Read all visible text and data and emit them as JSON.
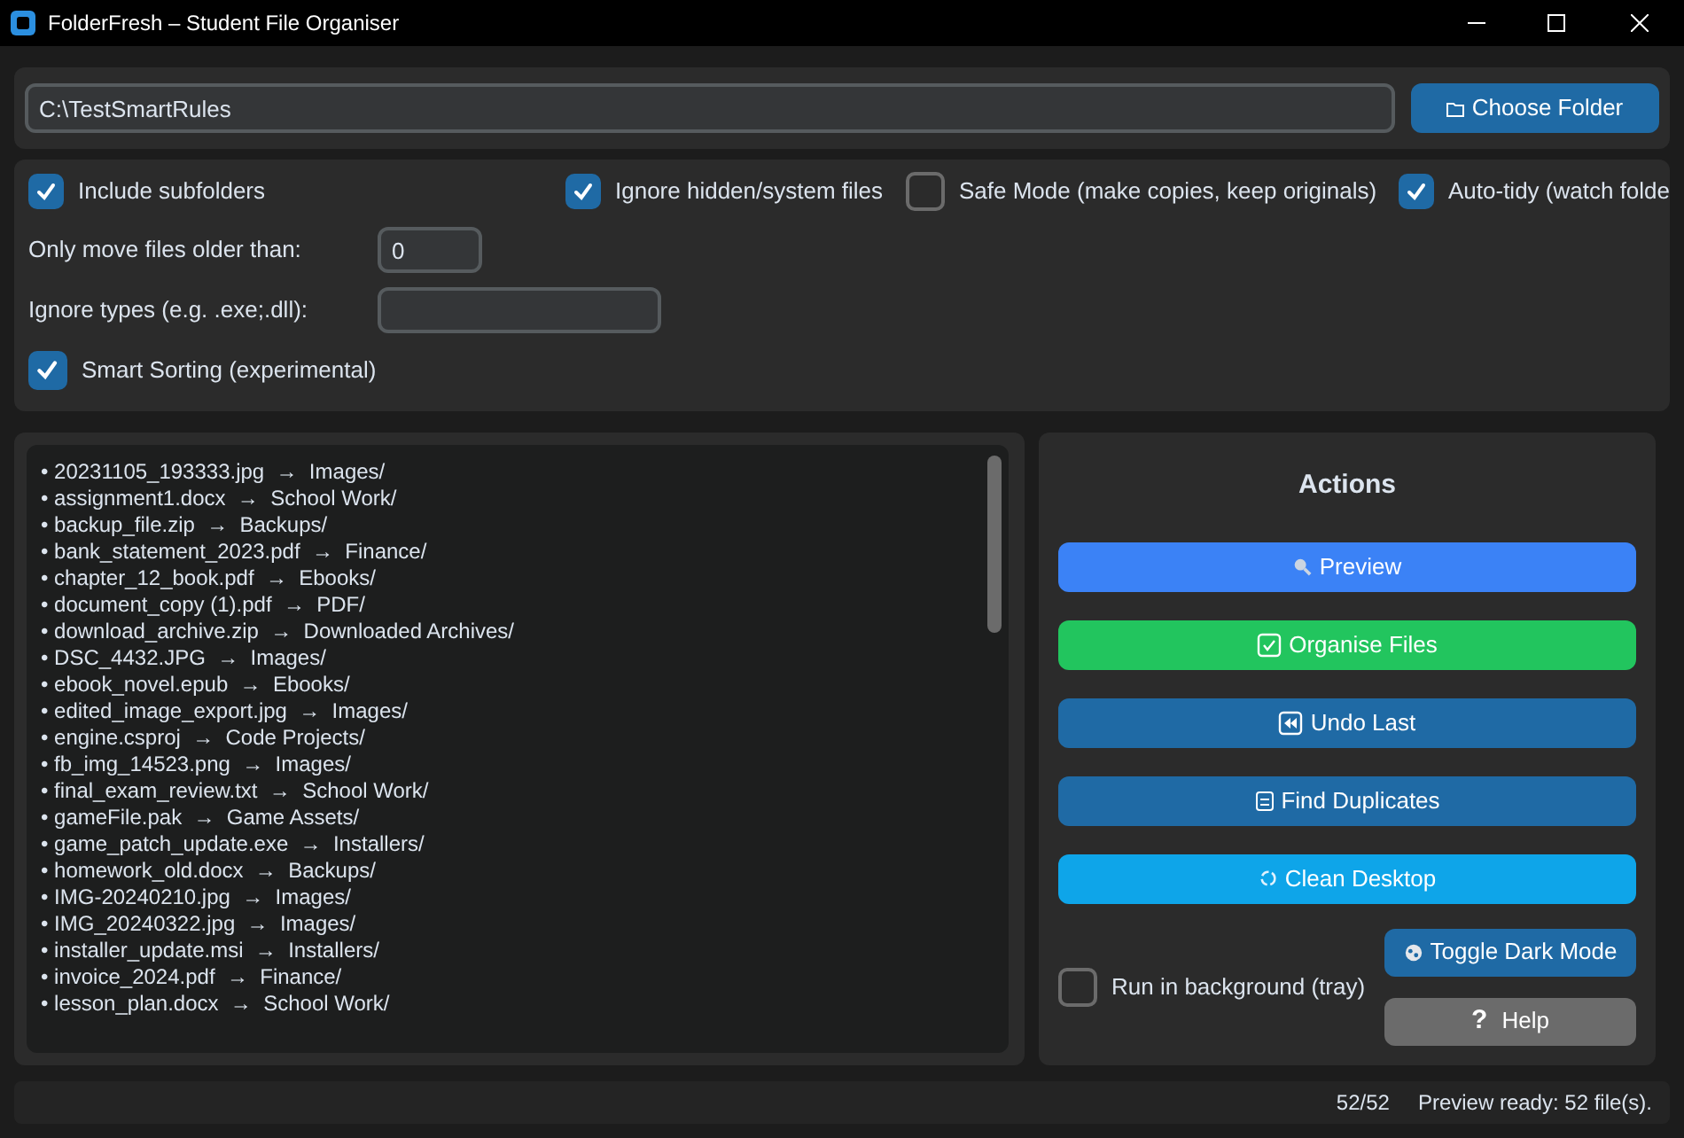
{
  "window": {
    "title": "FolderFresh – Student File Organiser"
  },
  "folder": {
    "path": "C:\\TestSmartRules",
    "button": "Choose Folder"
  },
  "options": [
    {
      "label": "Include subfolders",
      "checked": true
    },
    {
      "label": "Ignore hidden/system files",
      "checked": true
    },
    {
      "label": "Safe Mode (make copies, keep originals)",
      "checked": false
    },
    {
      "label": "Auto-tidy (watch folde",
      "checked": true
    }
  ],
  "fields": [
    {
      "label": "Only move files older than:",
      "value": "0"
    },
    {
      "label": "Ignore types (e.g. .exe;.dll):"
    }
  ],
  "smart_sorting": {
    "label": "Smart Sorting (experimental)",
    "checked": true
  },
  "preview_lines": [
    "• 20231105_193333.jpg  →  Images/",
    "• assignment1.docx  →  School Work/",
    "• backup_file.zip  →  Backups/",
    "• bank_statement_2023.pdf  →  Finance/",
    "• chapter_12_book.pdf  →  Ebooks/",
    "• document_copy (1).pdf  →  PDF/",
    "• download_archive.zip  →  Downloaded Archives/",
    "• DSC_4432.JPG  →  Images/",
    "• ebook_novel.epub  →  Ebooks/",
    "• edited_image_export.jpg  →  Images/",
    "• engine.csproj  →  Code Projects/",
    "• fb_img_14523.png  →  Images/",
    "• final_exam_review.txt  →  School Work/",
    "• gameFile.pak  →  Game Assets/",
    "• game_patch_update.exe  →  Installers/",
    "• homework_old.docx  →  Backups/",
    "• IMG-20240210.jpg  →  Images/",
    "• IMG_20240322.jpg  →  Images/",
    "• installer_update.msi  →  Installers/",
    "• invoice_2024.pdf  →  Finance/",
    "• lesson_plan.docx  →  School Work/"
  ],
  "actions": {
    "title": "Actions",
    "buttons": [
      {
        "label": "Preview",
        "kind": "preview",
        "color": "#3b82f6"
      },
      {
        "label": "Organise Files",
        "kind": "organise",
        "color": "#22c55e"
      },
      {
        "label": "Undo Last",
        "kind": "undo",
        "color": "#1f6aa5"
      },
      {
        "label": "Find Duplicates",
        "kind": "duplicates",
        "color": "#1f6aa5"
      },
      {
        "label": "Clean Desktop",
        "kind": "clean",
        "color": "#0ea5e9"
      }
    ],
    "run_in_background": {
      "label": "Run in background (tray)",
      "checked": false
    },
    "toggle_dark_mode": "Toggle Dark Mode",
    "help": {
      "icon": "?",
      "label": "Help"
    }
  },
  "status_bar": {
    "count": "52/52",
    "message": "Preview ready: 52 file(s)."
  }
}
